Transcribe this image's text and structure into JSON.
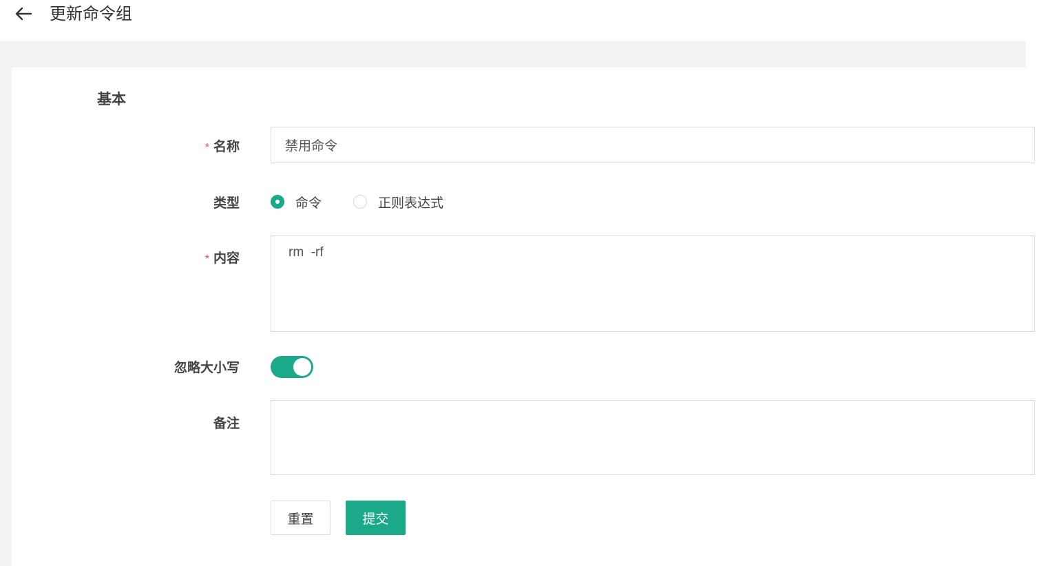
{
  "header": {
    "title": "更新命令组"
  },
  "section": {
    "title": "基本"
  },
  "form": {
    "name": {
      "label": "名称",
      "required": "*",
      "value": "禁用命令"
    },
    "type": {
      "label": "类型",
      "options": [
        {
          "label": "命令",
          "selected": true
        },
        {
          "label": "正则表达式",
          "selected": false
        }
      ]
    },
    "content": {
      "label": "内容",
      "required": "*",
      "value": "rm  -rf"
    },
    "ignore_case": {
      "label": "忽略大小写",
      "enabled": true
    },
    "remark": {
      "label": "备注",
      "value": ""
    }
  },
  "actions": {
    "reset_label": "重置",
    "submit_label": "提交"
  },
  "colors": {
    "accent": "#1aaa8a",
    "required": "#e5484d",
    "background": "#f2f2f2"
  },
  "icons": {
    "back": "arrow-left-icon"
  }
}
